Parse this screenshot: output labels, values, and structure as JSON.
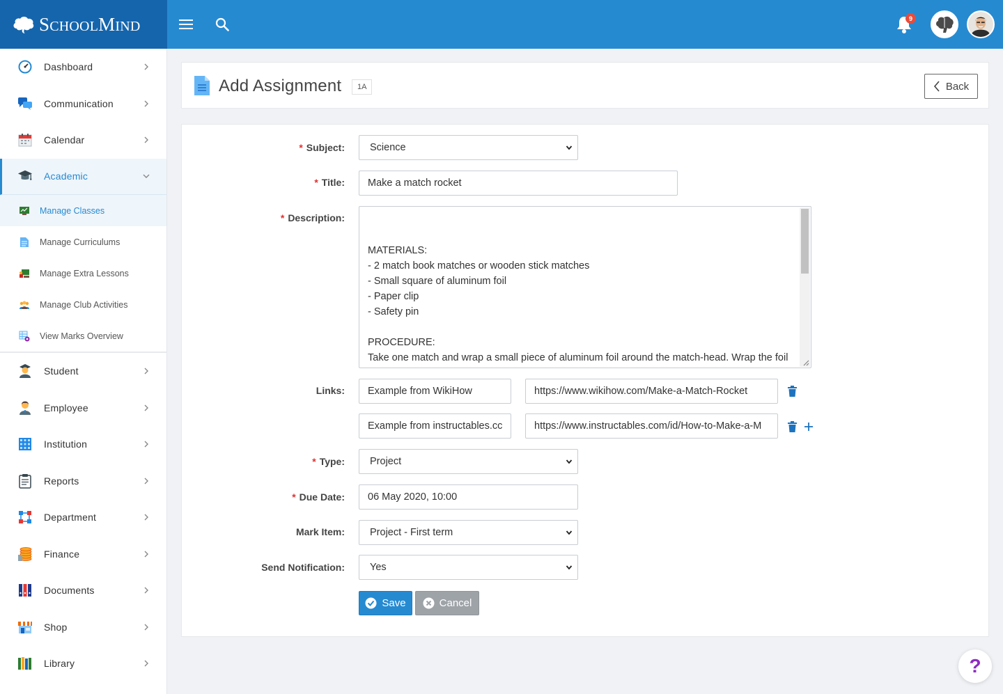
{
  "brand": {
    "name_big1": "S",
    "name_small1": "CHOOL",
    "name_big2": "M",
    "name_small2": "IND"
  },
  "topbar": {
    "notification_count": "9"
  },
  "sidebar": {
    "items": [
      {
        "label": "Dashboard"
      },
      {
        "label": "Communication"
      },
      {
        "label": "Calendar"
      },
      {
        "label": "Academic"
      },
      {
        "label": "Student"
      },
      {
        "label": "Employee"
      },
      {
        "label": "Institution"
      },
      {
        "label": "Reports"
      },
      {
        "label": "Department"
      },
      {
        "label": "Finance"
      },
      {
        "label": "Documents"
      },
      {
        "label": "Shop"
      },
      {
        "label": "Library"
      }
    ],
    "academic_sub": [
      {
        "label": "Manage Classes"
      },
      {
        "label": "Manage Curriculums"
      },
      {
        "label": "Manage Extra Lessons"
      },
      {
        "label": "Manage Club Activities"
      },
      {
        "label": "View Marks Overview"
      }
    ]
  },
  "header": {
    "title": "Add Assignment",
    "tag": "1A",
    "back_label": "Back"
  },
  "form": {
    "subject": {
      "label": "Subject:",
      "value": "Science"
    },
    "title": {
      "label": "Title:",
      "value": "Make a match rocket"
    },
    "description": {
      "label": "Description:",
      "value": "MATERIALS:\n- 2 match book matches or wooden stick matches\n- Small square of aluminum foil\n- Paper clip\n- Safety pin\n\nPROCEDURE:\nTake one match and wrap a small piece of aluminum foil around the match-head. Wrap the foil tightly."
    },
    "links": {
      "label": "Links:",
      "rows": [
        {
          "name": "Example from WikiHow",
          "url": "https://www.wikihow.com/Make-a-Match-Rocket"
        },
        {
          "name": "Example from instructables.cc",
          "url": "https://www.instructables.com/id/How-to-Make-a-M"
        }
      ]
    },
    "type": {
      "label": "Type:",
      "value": "Project"
    },
    "due_date": {
      "label": "Due Date:",
      "value": "06 May 2020, 10:00"
    },
    "mark_item": {
      "label": "Mark Item:",
      "value": "Project - First term"
    },
    "send_notification": {
      "label": "Send Notification:",
      "value": "Yes"
    },
    "required_mark": "*",
    "save_label": "Save",
    "cancel_label": "Cancel"
  },
  "help": {
    "label": "?"
  },
  "colors": {
    "primary": "#268ad1",
    "brand_dark": "#1565ad",
    "required": "#e03131",
    "cancel": "#9ea3a8",
    "help": "#8e2bc2"
  }
}
